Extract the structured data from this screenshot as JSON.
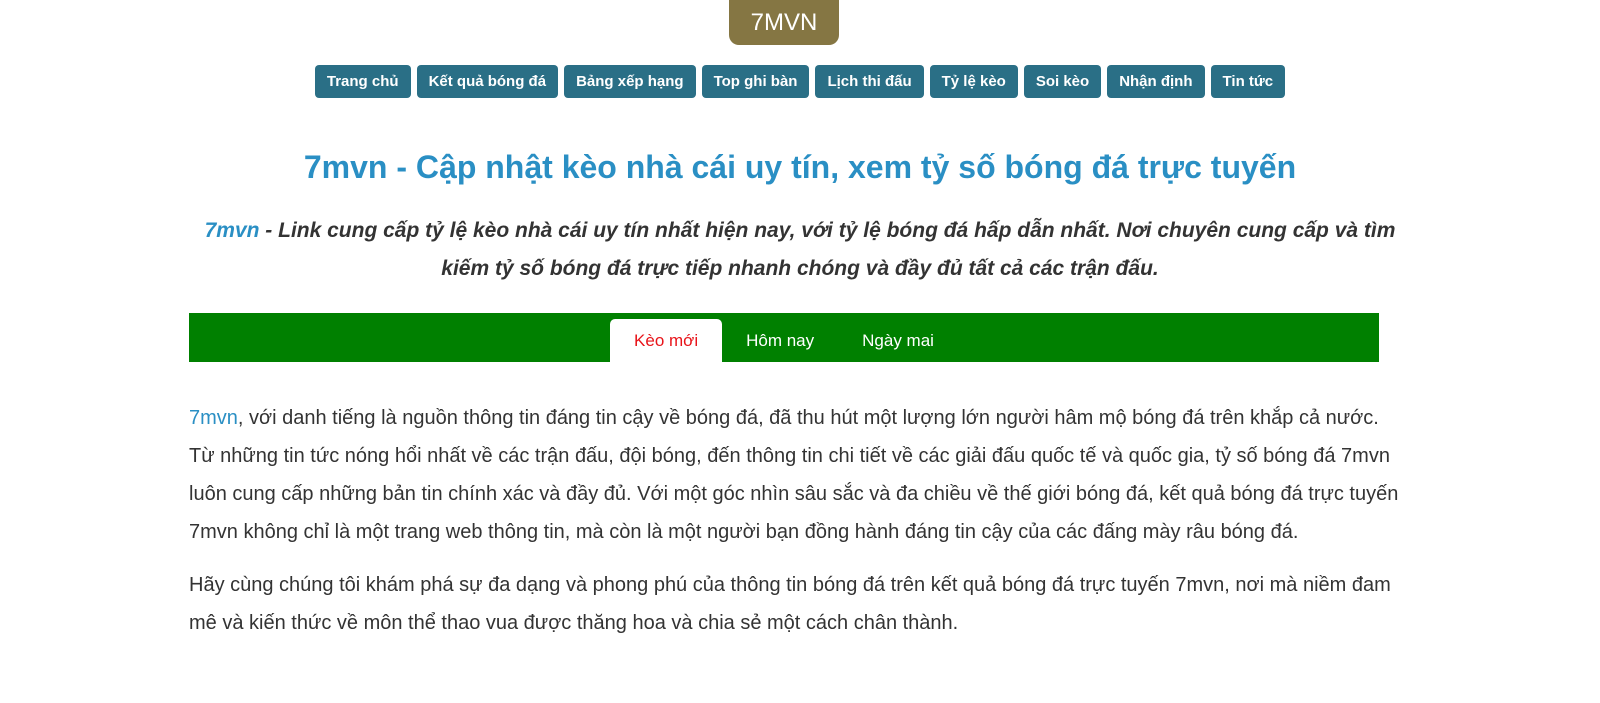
{
  "header": {
    "logo_text": "7MVN",
    "logo_color": "#857643"
  },
  "nav": {
    "items": [
      {
        "label": "Trang chủ"
      },
      {
        "label": "Kết quả bóng đá"
      },
      {
        "label": "Bảng xếp hạng"
      },
      {
        "label": "Top ghi bàn"
      },
      {
        "label": "Lịch thi đấu"
      },
      {
        "label": "Tỷ lệ kèo"
      },
      {
        "label": "Soi kèo"
      },
      {
        "label": "Nhận định"
      },
      {
        "label": "Tin tức"
      }
    ],
    "button_color": "#2a6f86"
  },
  "main": {
    "headline": "7mvn - Cập nhật kèo nhà cái uy tín, xem tỷ số bóng đá trực tuyến",
    "intro_brand": "7mvn",
    "intro_text": " - Link cung cấp tỷ lệ kèo nhà cái uy tín nhất hiện nay, với tỷ lệ bóng đá hấp dẫn nhất. Nơi chuyên cung cấp và tìm kiếm tỷ số bóng đá trực tiếp nhanh chóng và đầy đủ tất cả các trận đấu."
  },
  "tabs": {
    "items": [
      {
        "label": "Kèo mới",
        "active": true
      },
      {
        "label": "Hôm nay",
        "active": false
      },
      {
        "label": "Ngày mai",
        "active": false
      }
    ],
    "bar_color": "#008000",
    "active_text_color": "#e8141a"
  },
  "article": {
    "p1_link": "7mvn",
    "p1_text": ", với danh tiếng là nguồn thông tin đáng tin cậy về bóng đá, đã thu hút một lượng lớn người hâm mộ bóng đá trên khắp cả nước. Từ những tin tức nóng hổi nhất về các trận đấu, đội bóng, đến thông tin chi tiết về các giải đấu quốc tế và quốc gia, tỷ số bóng đá 7mvn luôn cung cấp những bản tin chính xác và đầy đủ. Với một góc nhìn sâu sắc và đa chiều về thế giới bóng đá, kết quả bóng đá trực tuyến 7mvn không chỉ là một trang web thông tin, mà còn là một người bạn đồng hành đáng tin cậy của các đấng mày râu bóng đá.",
    "p2_text": "Hãy cùng chúng tôi khám phá sự đa dạng và phong phú của thông tin bóng đá trên kết quả bóng đá trực tuyến 7mvn, nơi mà niềm đam mê và kiến thức về môn thể thao vua được thăng hoa và chia sẻ một cách chân thành.",
    "link_color": "#2a8fc4"
  }
}
